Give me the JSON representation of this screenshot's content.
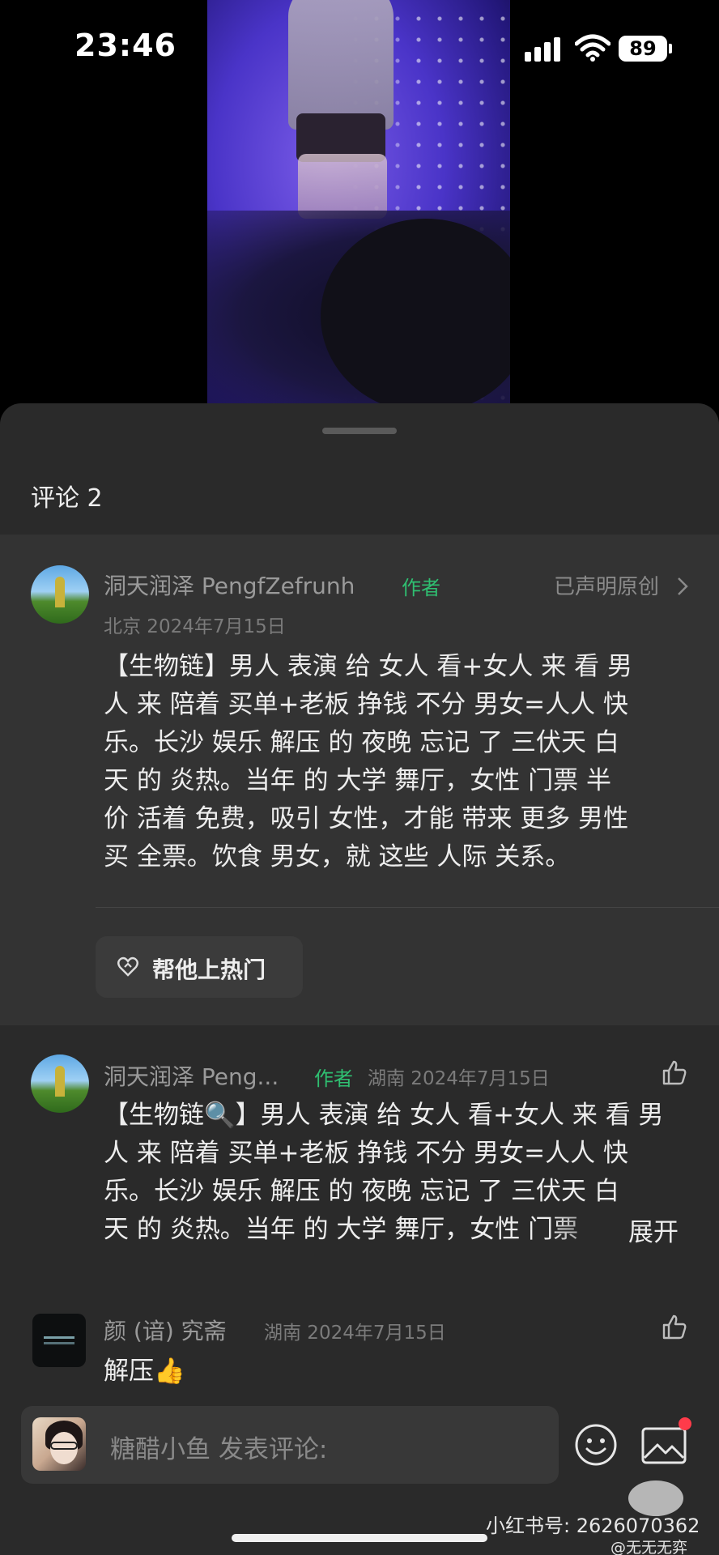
{
  "status_bar": {
    "time": "23:46",
    "battery": "89"
  },
  "comments": {
    "title": "评论 2",
    "pinned": {
      "name": "洞天润泽 PengfZefrunh",
      "author_tag": "作者",
      "declared": "已声明原创",
      "location_date": "北京 2024年7月15日",
      "lines": [
        "【生物链】男人 表演 给 女人 看+女人 来 看 男",
        "人 来 陪着 买单+老板 挣钱 不分 男女=人人 快",
        "乐。长沙 娱乐 解压 的 夜晚 忘记 了 三伏天 白",
        "天 的 炎热。当年 的 大学 舞厅，女性 门票 半",
        "价 活着 免费，吸引 女性，才能 带来 更多 男性",
        "买 全票。饮食 男女，就 这些 人际 关系。"
      ],
      "hot_button": "帮他上热门"
    },
    "items": [
      {
        "name": "洞天润泽 Peng...",
        "author_tag": "作者",
        "location_date": "湖南 2024年7月15日",
        "lines": [
          "【生物链🔍】男人 表演 给 女人 看+女人 来 看 男",
          "人 来 陪着 买单+老板 挣钱 不分 男女=人人 快",
          "乐。长沙 娱乐 解压 的 夜晚 忘记 了 三伏天 白",
          "天 的 炎热。当年 的 大学 舞厅，女性 门票"
        ],
        "expand": "展开"
      },
      {
        "name": "颜 (谙) 究斋",
        "location_date": "湖南 2024年7月15日",
        "text": "解压👍"
      }
    ]
  },
  "input": {
    "placeholder": "糖醋小鱼 发表评论:"
  },
  "watermark": {
    "line1": "小红书号: 2626070362",
    "line2": "@无无无弈"
  }
}
